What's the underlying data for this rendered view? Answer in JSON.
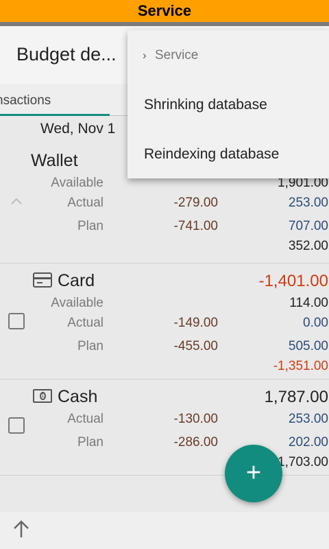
{
  "status_bar": {
    "title": "Service"
  },
  "app_bar": {
    "title": "Budget de..."
  },
  "tabs": {
    "partial_tab_label": "nsactions"
  },
  "date_header": "Wed, Nov 1",
  "accounts": [
    {
      "name": "Wallet",
      "available_label": "Available",
      "available_value": "1,901.00",
      "actual_label": "Actual",
      "actual_mid": "-279.00",
      "actual_right": "253.00",
      "plan_label": "Plan",
      "plan_mid": "-741.00",
      "plan_right": "707.00",
      "footer_value": "352.00"
    },
    {
      "name": "Card",
      "balance": "-1,401.00",
      "available_label": "Available",
      "available_value": "114.00",
      "actual_label": "Actual",
      "actual_mid": "-149.00",
      "actual_right": "0.00",
      "plan_label": "Plan",
      "plan_mid": "-455.00",
      "plan_right": "505.00",
      "footer_value": "-1,351.00"
    },
    {
      "name": "Cash",
      "balance": "1,787.00",
      "actual_label": "Actual",
      "actual_mid": "-130.00",
      "actual_right": "253.00",
      "plan_label": "Plan",
      "plan_mid": "-286.00",
      "plan_right": "202.00",
      "footer_value": "1,703.00"
    }
  ],
  "fab": {
    "label": "+"
  },
  "popup_menu": {
    "header": "Service",
    "items": [
      "Shrinking database",
      "Reindexing database"
    ]
  },
  "colors": {
    "accent": "#128c7e",
    "status_bar": "#ffa000",
    "negative": "#d23b11",
    "positive": "#2c4d7a"
  }
}
